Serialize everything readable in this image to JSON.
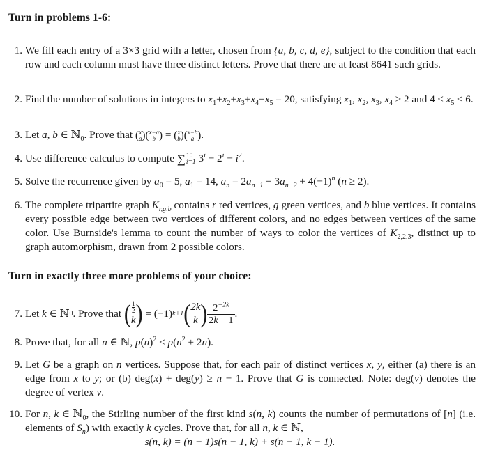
{
  "section1": {
    "heading": "Turn in problems 1-6:"
  },
  "section2": {
    "heading": "Turn in exactly three more problems of your choice:"
  },
  "problems": [
    {
      "number": "1.",
      "text": "We fill each entry of a 3×3 grid with a letter, chosen from {a, b, c, d, e}, subject to the condition that each row and each column must have three distinct letters. Prove that there are at least 8641 such grids."
    },
    {
      "number": "2.",
      "text": "Find the number of solutions in integers to x1+x2+x3+x4+x5 = 20, satisfying x1, x2, x3, x4 ≥ 2 and 4 ≤ x5 ≤ 6."
    },
    {
      "number": "3.",
      "text": "Let a, b ∈ ℕ0. Prove that C(x,a)C(x−a,b) = C(x,b)C(x−b,a)."
    },
    {
      "number": "4.",
      "text": "Use difference calculus to compute Σ_{i=1}^{10} 3^i − 2^i − i^2."
    },
    {
      "number": "5.",
      "text": "Solve the recurrence given by a0 = 5, a1 = 14, an = 2an−1 + 3an−2 + 4(−1)^n (n ≥ 2)."
    },
    {
      "number": "6.",
      "text": "The complete tripartite graph K_{r,g,b} contains r red vertices, g green vertices, and b blue vertices. It contains every possible edge between two vertices of different colors, and no edges between vertices of the same color. Use Burnside's lemma to count the number of ways to color the vertices of K_{2,2,3}, distinct up to graph automorphism, drawn from 2 possible colors."
    },
    {
      "number": "7.",
      "text": "Let k ∈ ℕ0. Prove that C(1/2,k) = (−1)^{k+1} C(2k,k) 2^{−2k}/(2k − 1)."
    },
    {
      "number": "8.",
      "text": "Prove that, for all n ∈ ℕ, p(n)^2 < p(n^2 + 2n)."
    },
    {
      "number": "9.",
      "text": "Let G be a graph on n vertices. Suppose that, for each pair of distinct vertices x, y, either (a) there is an edge from x to y; or (b) deg(x) + deg(y) ≥ n − 1. Prove that G is connected. Note: deg(v) denotes the degree of vertex v."
    },
    {
      "number": "10.",
      "text": "For n, k ∈ ℕ0, the Stirling number of the first kind s(n, k) counts the number of permutations of [n] (i.e. elements of Sn) with exactly k cycles. Prove that, for all n, k ∈ ℕ, s(n, k) = (n − 1)s(n − 1, k) + s(n − 1, k − 1)."
    }
  ],
  "frag": {
    "p1a": "We fill each entry of a 3",
    "p1times": "×",
    "p1b": "3 grid with a letter, chosen from ",
    "p1set": "{a, b, c, d, e}",
    "p1c": ", subject to the condition that each row and each column must have three distinct letters. Prove that there are at least 8641 such grids.",
    "p2a": "Find the number of solutions in integers to ",
    "p2eq": "= 20, satisfying ",
    "p2cond": "≥ 2",
    "p2and": "and 4 ≤ ",
    "p2le": " ≤ 6.",
    "p3a": "Let ",
    "p3vars": "a, b",
    "p3in": " ∈ ℕ",
    "p3zero": "0",
    "p3b": ". Prove that ",
    "p4a": "Use difference calculus to compute ",
    "p4upper": "10",
    "p4lower": "i=1",
    "p5a": "Solve the recurrence given by ",
    "p6a": "The complete tripartite graph ",
    "p6b": " contains ",
    "p6c": " red vertices, ",
    "p6d": " green vertices, and ",
    "p6e": " blue vertices. It contains every possible edge between two vertices of different colors, and no edges between vertices of the same color. Use Burnside's lemma to count the number of ways to color the vertices of ",
    "p6f": ", distinct up to graph automorphism, drawn from 2 possible colors.",
    "p7a": "Let ",
    "p7b": ". Prove that ",
    "p8a": "Prove that, for all ",
    "p9a": "Let ",
    "p9b": " be a graph on ",
    "p9c": " vertices. Suppose that, for each pair of distinct vertices ",
    "p9d": ", either (a) there is an edge from ",
    "p9e": " to ",
    "p9f": "; or (b) deg(",
    "p9g": ") + deg(",
    "p9h": ") ≥ ",
    "p9i": " − 1. Prove that ",
    "p9j": " is connected. Note: deg(",
    "p9k": ") denotes the degree of vertex ",
    "p10a": "For ",
    "p10b": ", the Stirling number of the first kind ",
    "p10c": " counts the number of permutations of [",
    "p10d": "] (i.e. elements of ",
    "p10e": ") with exactly ",
    "p10f": " cycles. Prove that, for all ",
    "p10eq": "s(n, k) = (n − 1)s(n − 1, k) + s(n − 1, k − 1)."
  }
}
